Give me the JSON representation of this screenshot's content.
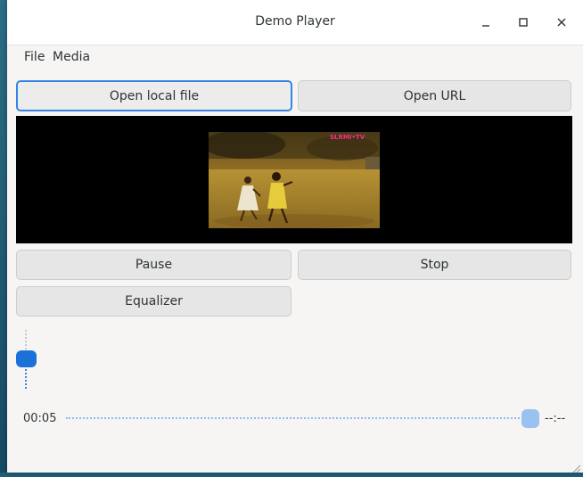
{
  "window": {
    "title": "Demo Player"
  },
  "menubar": {
    "items": [
      "File",
      "Media"
    ]
  },
  "buttons": {
    "open_local": "Open local file",
    "open_url": "Open URL",
    "pause": "Pause",
    "stop": "Stop",
    "equalizer": "Equalizer"
  },
  "video": {
    "watermark": "SLRMI•TV"
  },
  "playback": {
    "current_time": "00:05",
    "total_time": "--:--",
    "seek_position": 0.99,
    "volume_level": 0.5
  },
  "colors": {
    "accent": "#3584e4",
    "window_bg": "#f6f5f4",
    "button_bg": "#e6e6e6",
    "seek_handle": "#99c1f1",
    "volume_handle": "#1c71d8",
    "watermark": "#ff2a8a"
  },
  "icons": [
    "minimize-icon",
    "maximize-icon",
    "close-icon",
    "resize-grip-icon"
  ]
}
